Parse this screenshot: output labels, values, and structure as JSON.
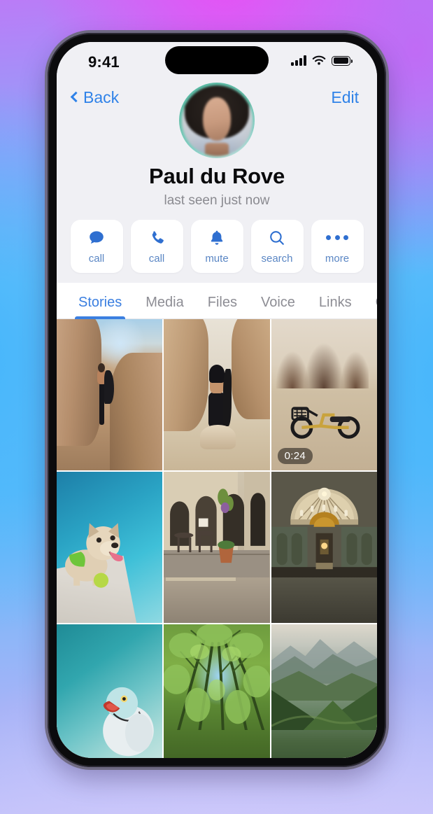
{
  "statusbar": {
    "time": "9:41",
    "icons": [
      "cellular-signal-icon",
      "wifi-icon",
      "battery-icon"
    ]
  },
  "navbar": {
    "back_label": "Back",
    "edit_label": "Edit",
    "back_icon": "chevron-left-icon"
  },
  "profile": {
    "name": "Paul du Rove",
    "status": "last seen just now",
    "avatar_alt": "profile-photo",
    "story_ring_color": "#5cbfa8"
  },
  "actions": [
    {
      "icon": "chat-bubble-icon",
      "label": "call"
    },
    {
      "icon": "phone-icon",
      "label": "call"
    },
    {
      "icon": "bell-icon",
      "label": "mute"
    },
    {
      "icon": "magnifier-icon",
      "label": "search"
    },
    {
      "icon": "ellipsis-icon",
      "label": "more"
    }
  ],
  "tabs": [
    {
      "label": "Stories",
      "active": true
    },
    {
      "label": "Media",
      "active": false
    },
    {
      "label": "Files",
      "active": false
    },
    {
      "label": "Voice",
      "active": false
    },
    {
      "label": "Links",
      "active": false
    },
    {
      "label": "GIFs",
      "active": false
    }
  ],
  "grid": [
    {
      "scene": "s-canyon1",
      "alt": "man-in-desert-canyon",
      "duration": ""
    },
    {
      "scene": "s-canyon2",
      "alt": "hooded-man-on-rock",
      "duration": ""
    },
    {
      "scene": "s-desert",
      "alt": "motorbike-in-desert",
      "duration": "0:24"
    },
    {
      "scene": "s-dog",
      "alt": "french-bulldog-by-pool",
      "duration": ""
    },
    {
      "scene": "s-street",
      "alt": "european-street-cafe",
      "duration": ""
    },
    {
      "scene": "s-dome",
      "alt": "basilica-dome-interior",
      "duration": ""
    },
    {
      "scene": "s-parrot",
      "alt": "parrot-on-teal-fabric",
      "duration": ""
    },
    {
      "scene": "s-forest",
      "alt": "forest-canopy-upward",
      "duration": ""
    },
    {
      "scene": "s-mtn",
      "alt": "green-mountain-valley",
      "duration": ""
    }
  ],
  "colors": {
    "accent": "#3b7fe0",
    "ios_blue": "#2f82e8",
    "action_label": "#5a86c4",
    "header_bg": "#f0f0f4",
    "tab_inactive": "#8d8d94"
  }
}
